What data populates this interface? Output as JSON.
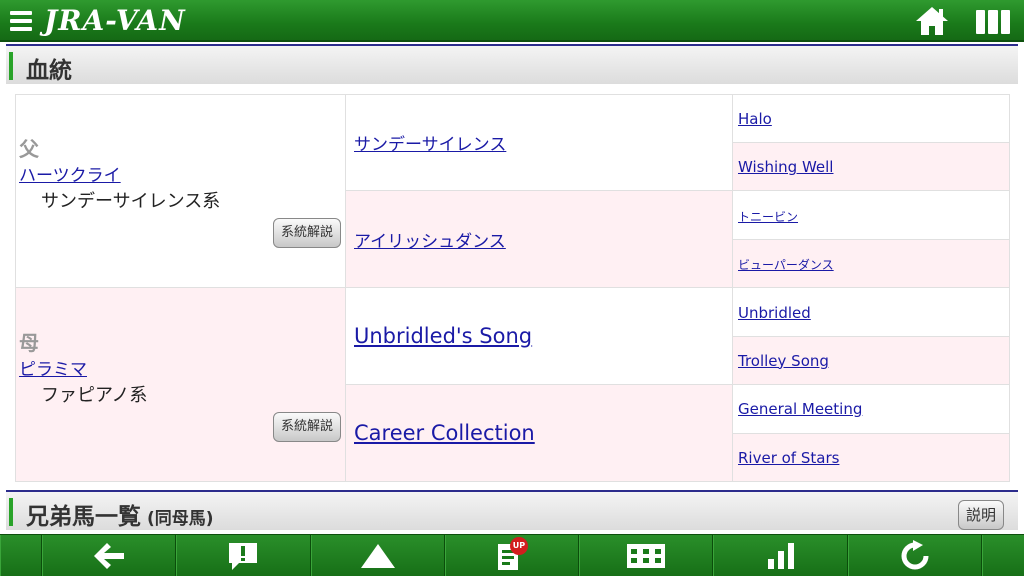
{
  "app": {
    "logo": "JRA-VAN"
  },
  "section": {
    "title": "血統"
  },
  "pedigree": {
    "sire": {
      "relation": "父",
      "name": "ハーツクライ",
      "line": "サンデーサイレンス系",
      "explain_label": "系統解説",
      "sire": {
        "name": "サンデーサイレンス",
        "sire": "Halo",
        "dam": "Wishing Well"
      },
      "dam": {
        "name": "アイリッシュダンス",
        "sire": "トニービン",
        "dam": "ビューパーダンス"
      }
    },
    "dam": {
      "relation": "母",
      "name": "ピラミマ",
      "line": "ファピアノ系",
      "explain_label": "系統解説",
      "sire": {
        "name": "Unbridled's Song",
        "sire": "Unbridled",
        "dam": "Trolley Song"
      },
      "dam": {
        "name": "Career Collection",
        "sire": "General Meeting",
        "dam": "River of Stars"
      }
    }
  },
  "siblings": {
    "title": "兄弟馬一覧",
    "subtitle": "(同母馬)",
    "explain_label": "説明"
  },
  "toolbar": {
    "icons": [
      "back-arrow-icon",
      "alert-icon",
      "course-icon",
      "news-up-icon",
      "schedule-icon",
      "chart-icon",
      "refresh-icon"
    ],
    "badge": "UP"
  }
}
